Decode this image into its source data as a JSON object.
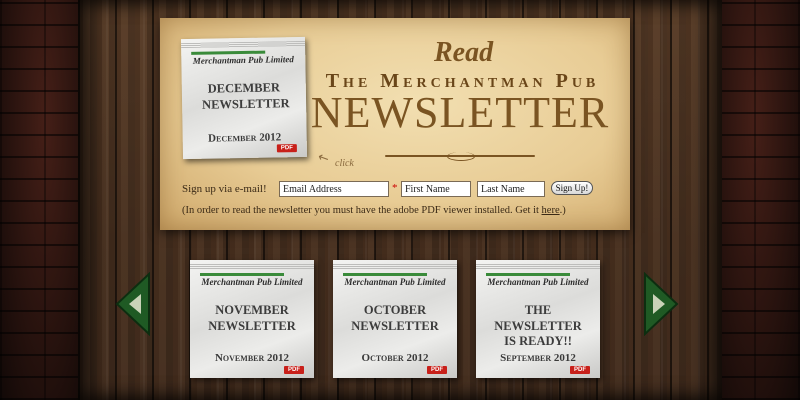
{
  "colors": {
    "accent": "#7a5422",
    "pdf_badge": "#c8201a",
    "masthead_bar": "#3a8b3a"
  },
  "featured": {
    "masthead": "Merchantman Pub Limited",
    "headline": "DECEMBER NEWSLETTER",
    "date": "December 2012",
    "pdf": "PDF"
  },
  "heading": {
    "read": "Read",
    "pub_name": "The Merchantman Pub",
    "title": "NEWSLETTER",
    "click_hint": "click"
  },
  "signup": {
    "label": "Sign up via e-mail!",
    "email_value": "Email Address",
    "first_name_value": "First Name",
    "last_name_value": "Last Name",
    "button": "Sign Up!",
    "note_prefix": "(In order to read the newsletter you must have the adobe PDF viewer installed. Get it ",
    "note_link": "here",
    "note_suffix": ".)"
  },
  "archive": [
    {
      "masthead": "Merchantman Pub Limited",
      "headline": "NOVEMBER NEWSLETTER",
      "date": "November 2012",
      "pdf": "PDF"
    },
    {
      "masthead": "Merchantman Pub Limited",
      "headline": "OCTOBER NEWSLETTER",
      "date": "October 2012",
      "pdf": "PDF"
    },
    {
      "masthead": "Merchantman Pub Limited",
      "headline": "THE NEWSLETTER IS READY!!",
      "date": "September 2012",
      "pdf": "PDF"
    }
  ],
  "nav": {
    "prev_icon": "triangle-left-icon",
    "next_icon": "triangle-right-icon"
  }
}
